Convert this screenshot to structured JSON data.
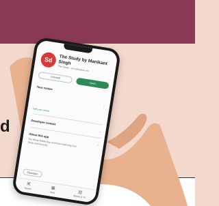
{
  "backdrop": {
    "partial_heading": "d"
  },
  "phone_app": {
    "title": "The Study by Manikant Singh",
    "publisher": "The Study · an education inc",
    "logo_glyph": "Sd",
    "buttons": {
      "uninstall": "Uninstall",
      "open": "Open"
    },
    "sections": {
      "review": {
        "title": "Your review",
        "action": "Edit your review"
      },
      "developer": {
        "title": "Developer contact"
      },
      "about": {
        "title": "About this app",
        "description": "The Study Mobile App and more improving Test Study and Ancestry"
      }
    },
    "chip": "Education",
    "nav": [
      {
        "label": "Games",
        "icon": "gamepad-icon"
      },
      {
        "label": "Apps",
        "icon": "apps-icon"
      },
      {
        "label": "Movies & TV",
        "icon": "film-icon"
      }
    ]
  },
  "colors": {
    "top_band": "#8a3a57",
    "peach": "#f3d8cd",
    "accent_green": "#2e8a57",
    "logo_red": "#d83b36"
  }
}
